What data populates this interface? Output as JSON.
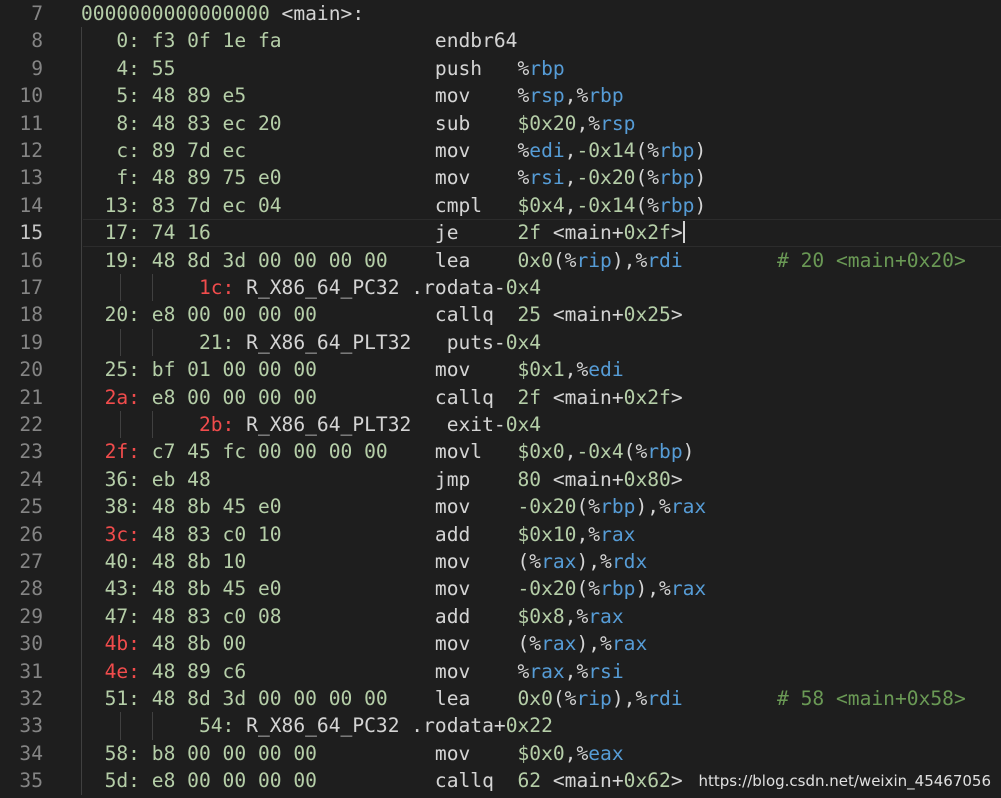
{
  "first_line_number": 7,
  "active_line_number": 15,
  "lines": [
    [
      [
        "0000000000000000",
        "num"
      ],
      [
        " <main>:",
        "txt"
      ]
    ],
    [
      [
        "   0:",
        "num"
      ],
      [
        " f3 0f 1e fa",
        "num"
      ],
      [
        "             endbr64",
        "txt"
      ]
    ],
    [
      [
        "   4:",
        "num"
      ],
      [
        " 55",
        "num"
      ],
      [
        "                      push   ",
        "txt"
      ],
      [
        "%",
        "txt"
      ],
      [
        "rbp",
        "reg"
      ]
    ],
    [
      [
        "   5:",
        "num"
      ],
      [
        " 48 89 e5",
        "num"
      ],
      [
        "                mov    ",
        "txt"
      ],
      [
        "%",
        "txt"
      ],
      [
        "rsp",
        "reg"
      ],
      [
        ",%",
        "txt"
      ],
      [
        "rbp",
        "reg"
      ]
    ],
    [
      [
        "   8:",
        "num"
      ],
      [
        " 48 83 ec 20",
        "num"
      ],
      [
        "             sub    ",
        "txt"
      ],
      [
        "$0x20",
        "num"
      ],
      [
        ",%",
        "txt"
      ],
      [
        "rsp",
        "reg"
      ]
    ],
    [
      [
        "   c:",
        "num"
      ],
      [
        " 89 7d ec",
        "num"
      ],
      [
        "                mov    ",
        "txt"
      ],
      [
        "%",
        "txt"
      ],
      [
        "edi",
        "reg"
      ],
      [
        ",",
        "txt"
      ],
      [
        "-0x14",
        "num"
      ],
      [
        "(%",
        "txt"
      ],
      [
        "rbp",
        "reg"
      ],
      [
        ")",
        "txt"
      ]
    ],
    [
      [
        "   f:",
        "num"
      ],
      [
        " 48 89 75 e0",
        "num"
      ],
      [
        "             mov    ",
        "txt"
      ],
      [
        "%",
        "txt"
      ],
      [
        "rsi",
        "reg"
      ],
      [
        ",",
        "txt"
      ],
      [
        "-0x20",
        "num"
      ],
      [
        "(%",
        "txt"
      ],
      [
        "rbp",
        "reg"
      ],
      [
        ")",
        "txt"
      ]
    ],
    [
      [
        "  13:",
        "num"
      ],
      [
        " 83 7d ec 04",
        "num"
      ],
      [
        "             cmpl   ",
        "txt"
      ],
      [
        "$0x4",
        "num"
      ],
      [
        ",",
        "txt"
      ],
      [
        "-0x14",
        "num"
      ],
      [
        "(%",
        "txt"
      ],
      [
        "rbp",
        "reg"
      ],
      [
        ")",
        "txt"
      ]
    ],
    [
      [
        "  17:",
        "num"
      ],
      [
        " 74 16",
        "num"
      ],
      [
        "                   je     ",
        "txt"
      ],
      [
        "2f",
        "num"
      ],
      [
        " <main+",
        "txt"
      ],
      [
        "0x2f",
        "num"
      ],
      [
        ">",
        "txt"
      ]
    ],
    [
      [
        "  19:",
        "num"
      ],
      [
        " 48 8d 3d 00 00 00 00",
        "num"
      ],
      [
        "    lea    ",
        "txt"
      ],
      [
        "0x0",
        "num"
      ],
      [
        "(%",
        "txt"
      ],
      [
        "rip",
        "reg"
      ],
      [
        "),%",
        "txt"
      ],
      [
        "rdi",
        "reg"
      ],
      [
        "        # 20 <main+0x20>",
        "cmt"
      ]
    ],
    [
      [
        "          ",
        "txt"
      ],
      [
        "1c:",
        "red"
      ],
      [
        " R_X86_64_PC32 .rodata-",
        "txt"
      ],
      [
        "0x4",
        "num"
      ]
    ],
    [
      [
        "  20:",
        "num"
      ],
      [
        " e8 00 00 00 00",
        "num"
      ],
      [
        "          callq  ",
        "txt"
      ],
      [
        "25",
        "num"
      ],
      [
        " <main+",
        "txt"
      ],
      [
        "0x25",
        "num"
      ],
      [
        ">",
        "txt"
      ]
    ],
    [
      [
        "          ",
        "txt"
      ],
      [
        "21:",
        "num"
      ],
      [
        " R_X86_64_PLT32   puts-",
        "txt"
      ],
      [
        "0x4",
        "num"
      ]
    ],
    [
      [
        "  25:",
        "num"
      ],
      [
        " bf 01 00 00 00",
        "num"
      ],
      [
        "          mov    ",
        "txt"
      ],
      [
        "$0x1",
        "num"
      ],
      [
        ",%",
        "txt"
      ],
      [
        "edi",
        "reg"
      ]
    ],
    [
      [
        "  2a:",
        "red"
      ],
      [
        " e8 00 00 00 00",
        "num"
      ],
      [
        "          callq  ",
        "txt"
      ],
      [
        "2f",
        "num"
      ],
      [
        " <main+",
        "txt"
      ],
      [
        "0x2f",
        "num"
      ],
      [
        ">",
        "txt"
      ]
    ],
    [
      [
        "          ",
        "txt"
      ],
      [
        "2b:",
        "red"
      ],
      [
        " R_X86_64_PLT32   exit-",
        "txt"
      ],
      [
        "0x4",
        "num"
      ]
    ],
    [
      [
        "  2f:",
        "red"
      ],
      [
        " c7 45 fc 00 00 00 00",
        "num"
      ],
      [
        "    movl   ",
        "txt"
      ],
      [
        "$0x0",
        "num"
      ],
      [
        ",",
        "txt"
      ],
      [
        "-0x4",
        "num"
      ],
      [
        "(%",
        "txt"
      ],
      [
        "rbp",
        "reg"
      ],
      [
        ")",
        "txt"
      ]
    ],
    [
      [
        "  36:",
        "num"
      ],
      [
        " eb 48",
        "num"
      ],
      [
        "                   jmp    ",
        "txt"
      ],
      [
        "80",
        "num"
      ],
      [
        " <main+",
        "txt"
      ],
      [
        "0x80",
        "num"
      ],
      [
        ">",
        "txt"
      ]
    ],
    [
      [
        "  38:",
        "num"
      ],
      [
        " 48 8b 45 e0",
        "num"
      ],
      [
        "             mov    ",
        "txt"
      ],
      [
        "-0x20",
        "num"
      ],
      [
        "(%",
        "txt"
      ],
      [
        "rbp",
        "reg"
      ],
      [
        "),%",
        "txt"
      ],
      [
        "rax",
        "reg"
      ]
    ],
    [
      [
        "  3c:",
        "red"
      ],
      [
        " 48 83 c0 10",
        "num"
      ],
      [
        "             add    ",
        "txt"
      ],
      [
        "$0x10",
        "num"
      ],
      [
        ",%",
        "txt"
      ],
      [
        "rax",
        "reg"
      ]
    ],
    [
      [
        "  40:",
        "num"
      ],
      [
        " 48 8b 10",
        "num"
      ],
      [
        "                mov    ",
        "txt"
      ],
      [
        "(%",
        "txt"
      ],
      [
        "rax",
        "reg"
      ],
      [
        "),%",
        "txt"
      ],
      [
        "rdx",
        "reg"
      ]
    ],
    [
      [
        "  43:",
        "num"
      ],
      [
        " 48 8b 45 e0",
        "num"
      ],
      [
        "             mov    ",
        "txt"
      ],
      [
        "-0x20",
        "num"
      ],
      [
        "(%",
        "txt"
      ],
      [
        "rbp",
        "reg"
      ],
      [
        "),%",
        "txt"
      ],
      [
        "rax",
        "reg"
      ]
    ],
    [
      [
        "  47:",
        "num"
      ],
      [
        " 48 83 c0 08",
        "num"
      ],
      [
        "             add    ",
        "txt"
      ],
      [
        "$0x8",
        "num"
      ],
      [
        ",%",
        "txt"
      ],
      [
        "rax",
        "reg"
      ]
    ],
    [
      [
        "  4b:",
        "red"
      ],
      [
        " 48 8b 00",
        "num"
      ],
      [
        "                mov    ",
        "txt"
      ],
      [
        "(%",
        "txt"
      ],
      [
        "rax",
        "reg"
      ],
      [
        "),%",
        "txt"
      ],
      [
        "rax",
        "reg"
      ]
    ],
    [
      [
        "  4e:",
        "red"
      ],
      [
        " 48 89 c6",
        "num"
      ],
      [
        "                mov    ",
        "txt"
      ],
      [
        "%",
        "txt"
      ],
      [
        "rax",
        "reg"
      ],
      [
        ",%",
        "txt"
      ],
      [
        "rsi",
        "reg"
      ]
    ],
    [
      [
        "  51:",
        "num"
      ],
      [
        " 48 8d 3d 00 00 00 00",
        "num"
      ],
      [
        "    lea    ",
        "txt"
      ],
      [
        "0x0",
        "num"
      ],
      [
        "(%",
        "txt"
      ],
      [
        "rip",
        "reg"
      ],
      [
        "),%",
        "txt"
      ],
      [
        "rdi",
        "reg"
      ],
      [
        "        # 58 <main+0x58>",
        "cmt"
      ]
    ],
    [
      [
        "          ",
        "txt"
      ],
      [
        "54:",
        "num"
      ],
      [
        " R_X86_64_PC32 .rodata+",
        "txt"
      ],
      [
        "0x22",
        "num"
      ]
    ],
    [
      [
        "  58:",
        "num"
      ],
      [
        " b8 00 00 00 00",
        "num"
      ],
      [
        "          mov    ",
        "txt"
      ],
      [
        "$0x0",
        "num"
      ],
      [
        ",%",
        "txt"
      ],
      [
        "eax",
        "reg"
      ]
    ],
    [
      [
        "  5d:",
        "num"
      ],
      [
        " e8 00 00 00 00",
        "num"
      ],
      [
        "          callq  ",
        "txt"
      ],
      [
        "62",
        "num"
      ],
      [
        " <main+",
        "txt"
      ],
      [
        "0x62",
        "num"
      ],
      [
        ">",
        "txt"
      ]
    ]
  ],
  "watermark": "https://blog.csdn.net/weixin_45467056"
}
